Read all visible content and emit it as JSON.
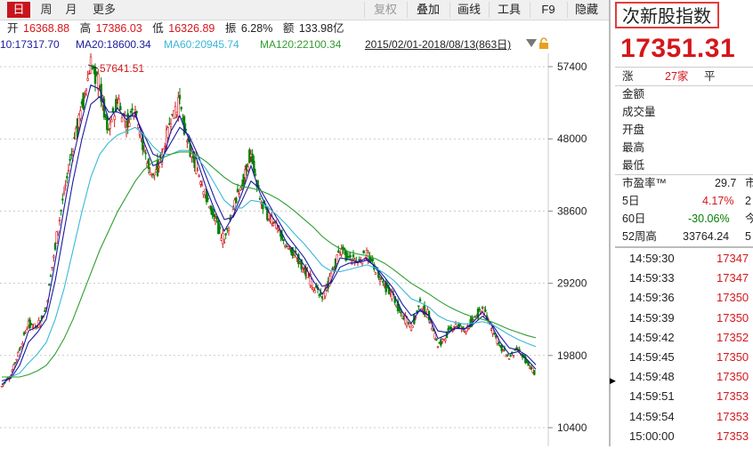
{
  "toolbar": {
    "periods": [
      "日",
      "周",
      "月",
      "更多"
    ],
    "active_period": "日",
    "buttons": [
      "复权",
      "叠加",
      "画线",
      "工具",
      "F9",
      "隐藏"
    ],
    "disabled_button": "复权"
  },
  "quote": {
    "open_label": "开",
    "open": "16368.88",
    "high_label": "高",
    "high": "17386.03",
    "low_label": "低",
    "low": "16326.89",
    "amp_label": "振",
    "amp": "6.28%",
    "amount_label": "额",
    "amount": "133.98亿"
  },
  "ma": {
    "ma10": "10:17317.70",
    "ma20": "MA20:18600.34",
    "ma60": "MA60:20945.74",
    "ma120": "MA120:22100.34",
    "range": "2015/02/01-2018/08/13(863日)"
  },
  "colors": {
    "up": "#d4171c",
    "down": "#008000",
    "ma10": "#1a1aa0",
    "ma20": "#1a1aa0",
    "ma60": "#3ab8d8",
    "ma120": "#2e9e2e",
    "accent": "#c8151c"
  },
  "chart_data": {
    "type": "candlestick",
    "y_ticks": [
      "57400",
      "48000",
      "38600",
      "29200",
      "19800",
      "10400"
    ],
    "ylim": [
      10400,
      57400
    ],
    "peak_label": "57641.51",
    "peak_value": 57641.51,
    "close_series": [
      15800,
      17200,
      20500,
      24000,
      23500,
      26000,
      34000,
      41000,
      47000,
      52000,
      57600,
      55000,
      49000,
      53000,
      50000,
      52500,
      46500,
      43000,
      45500,
      50500,
      52500,
      47000,
      44000,
      40500,
      37500,
      34500,
      39000,
      42000,
      46500,
      40000,
      38000,
      36500,
      34000,
      33000,
      31000,
      29000,
      27000,
      30000,
      33500,
      32500,
      32000,
      33000,
      31000,
      29000,
      27500,
      25000,
      23500,
      26500,
      25000,
      21000,
      22500,
      24000,
      23000,
      24500,
      26000,
      23500,
      21000,
      19500,
      20500,
      19000,
      17300
    ],
    "ma_series": {
      "ma10": [
        16000,
        17000,
        19500,
        23000,
        23600,
        25500,
        32000,
        39000,
        45500,
        50500,
        55000,
        54500,
        50500,
        52000,
        50500,
        51500,
        47500,
        44500,
        45000,
        49000,
        51000,
        48000,
        45000,
        41500,
        38500,
        36000,
        38000,
        41000,
        44500,
        41000,
        38500,
        36800,
        34500,
        33200,
        31500,
        29500,
        27800,
        29500,
        32500,
        32300,
        32000,
        32500,
        31200,
        29500,
        27800,
        25500,
        24000,
        25800,
        25000,
        22000,
        22500,
        23500,
        23200,
        24200,
        25500,
        23800,
        21500,
        20000,
        20300,
        19300,
        18000
      ],
      "ma20": [
        16500,
        16800,
        18500,
        21500,
        22800,
        24500,
        29500,
        36000,
        42500,
        48000,
        52500,
        53500,
        51500,
        51500,
        51000,
        51000,
        48500,
        46000,
        45500,
        47500,
        49500,
        48500,
        46000,
        43000,
        40000,
        37500,
        37800,
        40000,
        42500,
        41500,
        39500,
        37500,
        35500,
        34000,
        32500,
        30500,
        28800,
        29200,
        31300,
        31800,
        31900,
        32200,
        31400,
        30000,
        28500,
        26500,
        25000,
        25600,
        25000,
        23000,
        22800,
        23300,
        23300,
        23900,
        24900,
        24000,
        22300,
        20800,
        20500,
        19800,
        18600
      ],
      "ma60": [
        17000,
        17000,
        17500,
        18800,
        20000,
        21500,
        24500,
        28500,
        33500,
        38500,
        43000,
        46000,
        47500,
        48500,
        49000,
        49500,
        48500,
        47000,
        46000,
        46000,
        46500,
        46500,
        45500,
        44000,
        42000,
        40000,
        39000,
        39000,
        40000,
        39800,
        39000,
        38000,
        36800,
        35500,
        34300,
        32900,
        31500,
        30800,
        30700,
        31000,
        31300,
        31600,
        31200,
        30500,
        29600,
        28400,
        27200,
        26700,
        26100,
        25000,
        24400,
        24100,
        23900,
        24000,
        24200,
        23900,
        23200,
        22500,
        21900,
        21400,
        20950
      ],
      "ma120": [
        17000,
        17000,
        17000,
        17300,
        17800,
        18500,
        20000,
        22000,
        24500,
        27500,
        30500,
        33500,
        36000,
        38500,
        40500,
        42500,
        44000,
        45000,
        45500,
        46000,
        46300,
        46300,
        45800,
        45000,
        44000,
        43000,
        42200,
        41800,
        41600,
        41300,
        40800,
        40200,
        39400,
        38500,
        37500,
        36500,
        35300,
        34400,
        33700,
        33300,
        33000,
        32800,
        32400,
        31800,
        31000,
        30100,
        29200,
        28500,
        27800,
        27000,
        26300,
        25700,
        25200,
        24800,
        24500,
        24200,
        23700,
        23200,
        22800,
        22400,
        22100
      ]
    }
  },
  "right_panel": {
    "index_name": "次新股指数",
    "price": "17351.31",
    "zhang_label": "涨",
    "zhang_count": "27家",
    "ping_label": "平",
    "rows": [
      {
        "label": "金额"
      },
      {
        "label": "成交量"
      },
      {
        "label": "开盘"
      },
      {
        "label": "最高"
      },
      {
        "label": "最低"
      }
    ],
    "stats": [
      {
        "label": "市盈率™",
        "value": "29.7",
        "extra": "市"
      },
      {
        "label": "5日",
        "value": "4.17%",
        "extra": "2"
      },
      {
        "label": "60日",
        "value": "-30.06%",
        "extra": "今"
      },
      {
        "label": "52周高",
        "value": "33764.24",
        "extra": "5"
      }
    ],
    "ticks": [
      {
        "time": "14:59:30",
        "price": "17347"
      },
      {
        "time": "14:59:33",
        "price": "17347"
      },
      {
        "time": "14:59:36",
        "price": "17350"
      },
      {
        "time": "14:59:39",
        "price": "17350"
      },
      {
        "time": "14:59:42",
        "price": "17352"
      },
      {
        "time": "14:59:45",
        "price": "17350"
      },
      {
        "time": "14:59:48",
        "price": "17350"
      },
      {
        "time": "14:59:51",
        "price": "17353"
      },
      {
        "time": "14:59:54",
        "price": "17353"
      },
      {
        "time": "15:00:00",
        "price": "17353"
      }
    ]
  }
}
